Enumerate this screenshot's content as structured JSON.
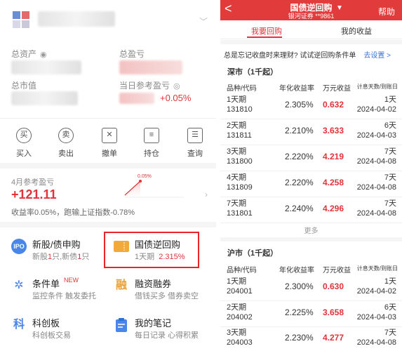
{
  "left": {
    "total_assets_label": "总资产",
    "total_pnl_label": "总盈亏",
    "market_value_label": "总市值",
    "today_pnl_label": "当日参考盈亏",
    "today_pnl_value": "+0.05%",
    "tools": [
      {
        "icon": "买",
        "label": "买入"
      },
      {
        "icon": "卖",
        "label": "卖出"
      },
      {
        "icon": "✕",
        "label": "撤单"
      },
      {
        "icon": "≡",
        "label": "持仓"
      },
      {
        "icon": "☰",
        "label": "查询"
      }
    ],
    "month": {
      "label": "4月参考盈亏",
      "value": "+121.11",
      "sub": "收益率0.05%，跑输上证指数-0.78%",
      "spark_label": "0.05%"
    },
    "features": {
      "ipo": {
        "icon": "IPO",
        "title": "新股/债申购",
        "sub_a": "新股",
        "sub_a_count": "1",
        "sub_a_unit": "只,新债",
        "sub_b_count": "1",
        "sub_b_unit": "只"
      },
      "repo": {
        "title": "国债逆回购",
        "sub_term": "1天期",
        "sub_rate": "2.315%"
      },
      "cond": {
        "title": "条件单",
        "tag": "NEW",
        "sub": "监控条件 触发委托"
      },
      "margin": {
        "icon": "融",
        "title": "融资融券",
        "sub": "借钱买多 借券卖空"
      },
      "star": {
        "icon": "科",
        "title": "科创板",
        "sub": "科创板交易"
      },
      "notes": {
        "title": "我的笔记",
        "sub": "每日记录 心得积累"
      }
    }
  },
  "right": {
    "header": {
      "back": "<",
      "title": "国债逆回购",
      "subtitle": "银河证券 **9861",
      "help": "帮助"
    },
    "tabs": {
      "buy": "我要回购",
      "income": "我的收益"
    },
    "tip": {
      "text": "总是忘记收盘时来理财? 试试逆回购条件单",
      "link": "去设置 >"
    },
    "sz": {
      "title": "深市（1千起）",
      "headers": {
        "code": "品种/代码",
        "rate": "年化收益率",
        "profit": "万元收益",
        "date": "计息天数/到账日"
      },
      "rows": [
        {
          "name": "1天期",
          "code": "131810",
          "rate": "2.305%",
          "profit": "0.632",
          "days": "1天",
          "date": "2024-04-02"
        },
        {
          "name": "2天期",
          "code": "131811",
          "rate": "2.210%",
          "profit": "3.633",
          "days": "6天",
          "date": "2024-04-03"
        },
        {
          "name": "3天期",
          "code": "131800",
          "rate": "2.220%",
          "profit": "4.219",
          "days": "7天",
          "date": "2024-04-08"
        },
        {
          "name": "4天期",
          "code": "131809",
          "rate": "2.220%",
          "profit": "4.258",
          "days": "7天",
          "date": "2024-04-08"
        },
        {
          "name": "7天期",
          "code": "131801",
          "rate": "2.240%",
          "profit": "4.296",
          "days": "7天",
          "date": "2024-04-08"
        }
      ],
      "more": "更多"
    },
    "sh": {
      "title": "沪市（1千起）",
      "headers": {
        "code": "品种/代码",
        "rate": "年化收益率",
        "profit": "万元收益",
        "date": "计息天数/到账日"
      },
      "rows": [
        {
          "name": "1天期",
          "code": "204001",
          "rate": "2.300%",
          "profit": "0.630",
          "days": "1天",
          "date": "2024-04-02"
        },
        {
          "name": "2天期",
          "code": "204002",
          "rate": "2.225%",
          "profit": "3.658",
          "days": "6天",
          "date": "2024-04-03"
        },
        {
          "name": "3天期",
          "code": "204003",
          "rate": "2.230%",
          "profit": "4.277",
          "days": "7天",
          "date": "2024-04-08"
        }
      ]
    }
  }
}
